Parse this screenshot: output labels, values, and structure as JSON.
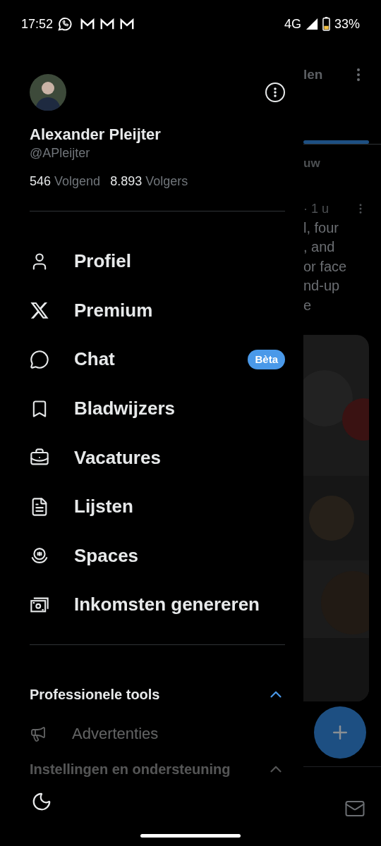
{
  "status_bar": {
    "time": "17:52",
    "network": "4G",
    "battery": "33%"
  },
  "profile": {
    "name": "Alexander Pleijter",
    "handle": "@APleijter",
    "following_count": "546",
    "following_label": "Volgend",
    "followers_count": "8.893",
    "followers_label": "Volgers"
  },
  "menu": [
    {
      "label": "Profiel"
    },
    {
      "label": "Premium"
    },
    {
      "label": "Chat",
      "badge": "Bèta"
    },
    {
      "label": "Bladwijzers"
    },
    {
      "label": "Vacatures"
    },
    {
      "label": "Lijsten"
    },
    {
      "label": "Spaces"
    },
    {
      "label": "Inkomsten genereren"
    }
  ],
  "sections": [
    {
      "title": "Professionele tools",
      "expanded": true,
      "children": [
        {
          "label": "Advertenties"
        }
      ]
    },
    {
      "title": "Instellingen en ondersteuning",
      "expanded": true
    }
  ],
  "background_timeline": {
    "tab": "len",
    "header": "uw",
    "time": "· 1 u",
    "post_lines": [
      "l, four",
      ", and",
      "or face",
      "nd-up",
      "e"
    ]
  }
}
